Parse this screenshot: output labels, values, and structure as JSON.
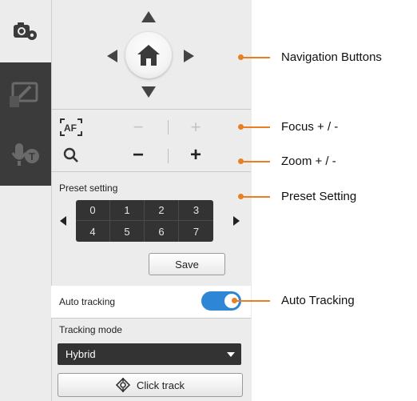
{
  "tabs": [
    {
      "icon": "camera-settings-icon"
    },
    {
      "icon": "screen-pen-icon"
    },
    {
      "icon": "voice-tracking-icon"
    }
  ],
  "navigation": {
    "icons": [
      "arrow-up-icon",
      "arrow-left-icon",
      "home-icon",
      "arrow-right-icon",
      "arrow-down-icon"
    ]
  },
  "focus": {
    "icon": "af-icon",
    "minus": "−",
    "plus": "+"
  },
  "zoom": {
    "icon": "magnifier-icon",
    "minus": "−",
    "plus": "+"
  },
  "preset": {
    "label": "Preset setting",
    "slots": [
      "0",
      "1",
      "2",
      "3",
      "4",
      "5",
      "6",
      "7"
    ],
    "save_label": "Save"
  },
  "auto_tracking": {
    "label": "Auto tracking",
    "enabled": true
  },
  "tracking_mode": {
    "label": "Tracking mode",
    "value": "Hybrid"
  },
  "click_track": {
    "label": "Click track"
  },
  "callouts": {
    "navigation": "Navigation Buttons",
    "focus": "Focus + / -",
    "zoom": "Zoom + / -",
    "preset": "Preset Setting",
    "auto_tracking": "Auto Tracking"
  },
  "colors": {
    "accent": "#2e86d6",
    "callout": "#e8801f",
    "dark_tab": "#3b3b3b",
    "panel": "#ececec"
  }
}
